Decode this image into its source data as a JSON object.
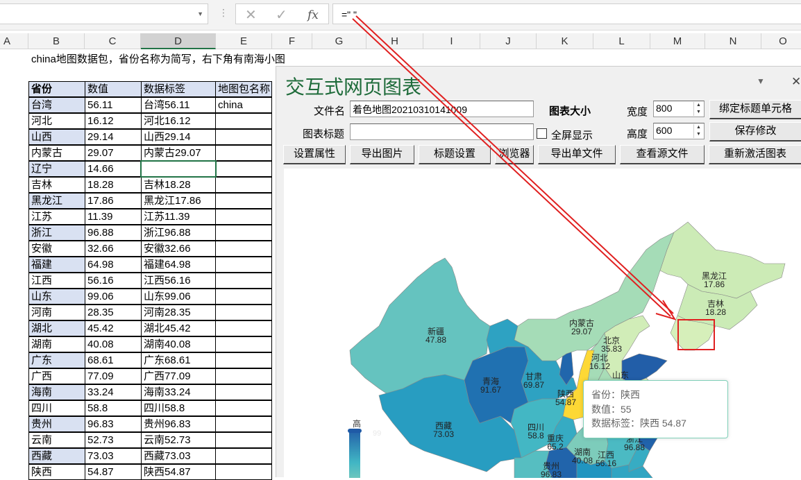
{
  "formula_bar": {
    "name_box": "",
    "formula": "=\" \"",
    "cancel_icon": "✕",
    "enter_icon": "✓",
    "fx_label": "fx"
  },
  "columns": [
    "A",
    "B",
    "C",
    "D",
    "E",
    "F",
    "G",
    "H",
    "I",
    "J",
    "K",
    "L",
    "M",
    "N",
    "O"
  ],
  "selected_column": "D",
  "note": "china地图数据包，省份名称为简写，右下角有南海小图",
  "table": {
    "headers": [
      "省份",
      "数值",
      "数据标签",
      "地图包名称"
    ],
    "map_package": "china",
    "rows": [
      [
        "台湾",
        "56.11",
        "台湾56.11"
      ],
      [
        "河北",
        "16.12",
        "河北16.12"
      ],
      [
        "山西",
        "29.14",
        "山西29.14"
      ],
      [
        "内蒙古",
        "29.07",
        "内蒙古29.07"
      ],
      [
        "辽宁",
        "14.66",
        ""
      ],
      [
        "吉林",
        "18.28",
        "吉林18.28"
      ],
      [
        "黑龙江",
        "17.86",
        "黑龙江17.86"
      ],
      [
        "江苏",
        "11.39",
        "江苏11.39"
      ],
      [
        "浙江",
        "96.88",
        "浙江96.88"
      ],
      [
        "安徽",
        "32.66",
        "安徽32.66"
      ],
      [
        "福建",
        "64.98",
        "福建64.98"
      ],
      [
        "江西",
        "56.16",
        "江西56.16"
      ],
      [
        "山东",
        "99.06",
        "山东99.06"
      ],
      [
        "河南",
        "28.35",
        "河南28.35"
      ],
      [
        "湖北",
        "45.42",
        "湖北45.42"
      ],
      [
        "湖南",
        "40.08",
        "湖南40.08"
      ],
      [
        "广东",
        "68.61",
        "广东68.61"
      ],
      [
        "广西",
        "77.09",
        "广西77.09"
      ],
      [
        "海南",
        "33.24",
        "海南33.24"
      ],
      [
        "四川",
        "58.8",
        "四川58.8"
      ],
      [
        "贵州",
        "96.83",
        "贵州96.83"
      ],
      [
        "云南",
        "52.73",
        "云南52.73"
      ],
      [
        "西藏",
        "73.03",
        "西藏73.03"
      ],
      [
        "陕西",
        "54.87",
        "陕西54.87"
      ]
    ]
  },
  "panel": {
    "title": "交互式网页图表",
    "menu_icon": "▼",
    "close_icon": "✕",
    "filename_label": "文件名",
    "filename_value": "着色地图20210310141009",
    "chart_title_label": "图表标题",
    "chart_title_value": "",
    "size_label": "图表大小",
    "fullscreen_label": "全屏显示",
    "fullscreen_checked": false,
    "width_label": "宽度",
    "width_value": "800",
    "height_label": "高度",
    "height_value": "600",
    "bind_title_button": "绑定标题单元格",
    "save_button": "保存修改",
    "buttons": [
      "设置属性",
      "导出图片",
      "标题设置",
      "浏览器",
      "导出单文件",
      "查看源文件",
      "重新激活图表"
    ]
  },
  "chart_data": {
    "type": "map",
    "map": "china",
    "visual_map": {
      "max_label": "高",
      "max": 99,
      "min": 0,
      "colors": [
        "#ffffcc",
        "#c7e9b4",
        "#7fcdbb",
        "#41b6c4",
        "#1d91c0",
        "#225ea8"
      ],
      "emphasis_color": "#fdd835"
    },
    "regions": [
      {
        "name": "新疆",
        "value": 47.88,
        "label": "新疆\n47.88"
      },
      {
        "name": "西藏",
        "value": 73.03,
        "label": "西藏\n73.03"
      },
      {
        "name": "青海",
        "value": 91.67,
        "label": "青海\n91.67"
      },
      {
        "name": "甘肃",
        "value": 69.87,
        "label": "甘肃\n69.87"
      },
      {
        "name": "宁夏",
        "value": null,
        "label": ""
      },
      {
        "name": "内蒙古",
        "value": 29.07,
        "label": "内蒙古\n29.07"
      },
      {
        "name": "黑龙江",
        "value": 17.86,
        "label": "黑龙江\n17.86"
      },
      {
        "name": "吉林",
        "value": 18.28,
        "label": "吉林\n18.28"
      },
      {
        "name": "辽宁",
        "value": 14.66,
        "label": ""
      },
      {
        "name": "北京",
        "value": 35.83,
        "label": "北京\n35.83"
      },
      {
        "name": "河北",
        "value": 16.12,
        "label": "河北\n16.12"
      },
      {
        "name": "山西",
        "value": 29.14,
        "label": ""
      },
      {
        "name": "陕西",
        "value": 54.87,
        "label": "陕西\n54.87",
        "highlighted": true
      },
      {
        "name": "山东",
        "value": 99.06,
        "label": "山东"
      },
      {
        "name": "河南",
        "value": 28.35,
        "label": ""
      },
      {
        "name": "湖北",
        "value": 45.42,
        "label": ""
      },
      {
        "name": "江苏",
        "value": 11.39,
        "label": ""
      },
      {
        "name": "浙江",
        "value": 96.88,
        "label": "浙江\n96.88"
      },
      {
        "name": "四川",
        "value": 58.8,
        "label": "四川\n58.8"
      },
      {
        "name": "重庆",
        "value": 65.2,
        "label": "重庆\n65.2"
      },
      {
        "name": "贵州",
        "value": 96.83,
        "label": "贵州\n96.83"
      },
      {
        "name": "湖南",
        "value": 40.08,
        "label": "湖南\n40.08"
      },
      {
        "name": "江西",
        "value": 56.16,
        "label": "江西\n56.16"
      },
      {
        "name": "福建",
        "value": 64.98,
        "label": ""
      },
      {
        "name": "云南",
        "value": 52.73,
        "label": ""
      },
      {
        "name": "广西",
        "value": 77.09,
        "label": ""
      },
      {
        "name": "广东",
        "value": 68.61,
        "label": ""
      }
    ],
    "tooltip": {
      "province_label": "省份：陕西",
      "value_label": "数值：55",
      "data_label": "数据标签：陕西 54.87"
    }
  },
  "annotation": {
    "color": "#e02020"
  }
}
